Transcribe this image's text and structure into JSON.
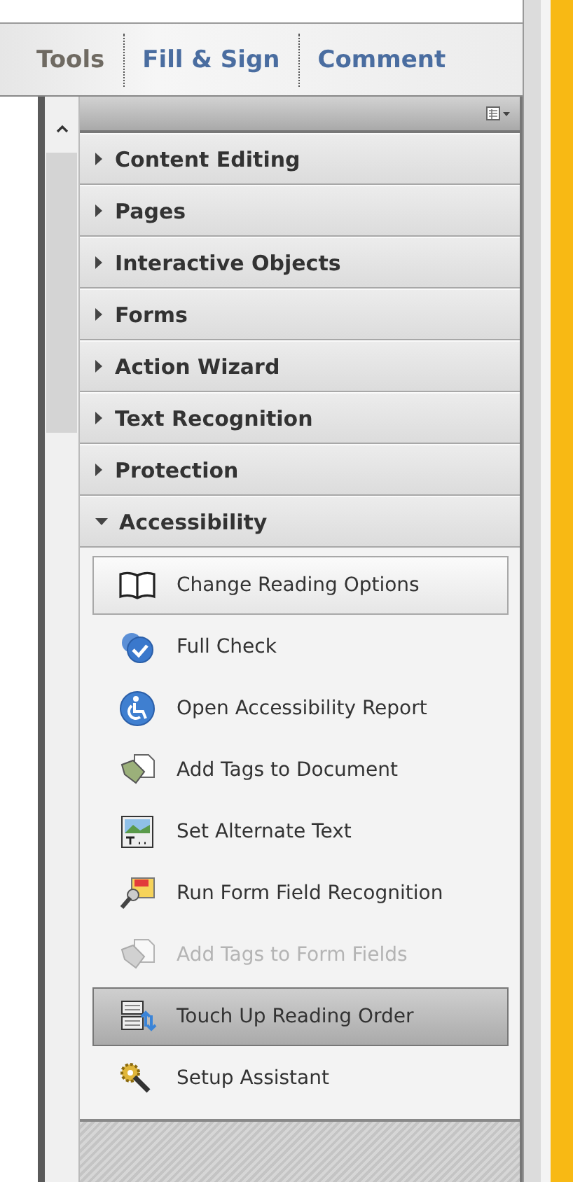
{
  "tabs": [
    {
      "label": "Tools",
      "selected": true
    },
    {
      "label": "Fill & Sign",
      "selected": false
    },
    {
      "label": "Comment",
      "selected": false
    }
  ],
  "sections": [
    {
      "label": "Content Editing",
      "expanded": false
    },
    {
      "label": "Pages",
      "expanded": false
    },
    {
      "label": "Interactive Objects",
      "expanded": false
    },
    {
      "label": "Forms",
      "expanded": false
    },
    {
      "label": "Action Wizard",
      "expanded": false
    },
    {
      "label": "Text Recognition",
      "expanded": false
    },
    {
      "label": "Protection",
      "expanded": false
    },
    {
      "label": "Accessibility",
      "expanded": true,
      "items": [
        {
          "label": "Change Reading Options",
          "hovered": true,
          "selected": false,
          "disabled": false
        },
        {
          "label": "Full Check",
          "hovered": false,
          "selected": false,
          "disabled": false
        },
        {
          "label": "Open Accessibility Report",
          "hovered": false,
          "selected": false,
          "disabled": false
        },
        {
          "label": "Add Tags to Document",
          "hovered": false,
          "selected": false,
          "disabled": false
        },
        {
          "label": "Set Alternate Text",
          "hovered": false,
          "selected": false,
          "disabled": false
        },
        {
          "label": "Run Form Field Recognition",
          "hovered": false,
          "selected": false,
          "disabled": false
        },
        {
          "label": "Add Tags to Form Fields",
          "hovered": false,
          "selected": false,
          "disabled": true
        },
        {
          "label": "Touch Up Reading Order",
          "hovered": false,
          "selected": true,
          "disabled": false
        },
        {
          "label": "Setup Assistant",
          "hovered": false,
          "selected": false,
          "disabled": false
        }
      ]
    }
  ]
}
